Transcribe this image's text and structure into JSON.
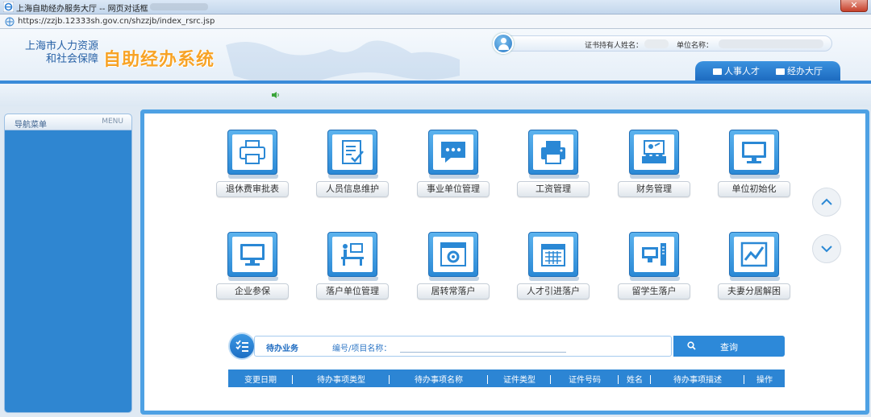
{
  "window": {
    "title": "上海自助经办服务大厅 -- 网页对话框",
    "url": "https://zzjb.12333sh.gov.cn/shzzjb/index_rsrc.jsp"
  },
  "header": {
    "org_line1": "上海市人力资源",
    "org_line2": "和社会保障",
    "system_name": "自助经办系统",
    "holder_label": "证书持有人姓名：",
    "unit_label": "单位名称："
  },
  "tabs": [
    {
      "label": "人事人才"
    },
    {
      "label": "经办大厅"
    }
  ],
  "sidebar": {
    "title": "导航菜单",
    "menu": "MENU"
  },
  "functions": [
    {
      "label": "退休费审批表",
      "icon": "printer-icon"
    },
    {
      "label": "人员信息维护",
      "icon": "document-edit-icon"
    },
    {
      "label": "事业单位管理",
      "icon": "chat-bubble-icon"
    },
    {
      "label": "工资管理",
      "icon": "printer-icon"
    },
    {
      "label": "财务管理",
      "icon": "presentation-icon"
    },
    {
      "label": "单位初始化",
      "icon": "monitor-icon"
    },
    {
      "label": "企业参保",
      "icon": "monitor-icon"
    },
    {
      "label": "落户单位管理",
      "icon": "desk-icon"
    },
    {
      "label": "居转常落户",
      "icon": "browser-gear-icon"
    },
    {
      "label": "人才引进落户",
      "icon": "calendar-icon"
    },
    {
      "label": "留学生落户",
      "icon": "computer-tower-icon"
    },
    {
      "label": "夫妻分居解困",
      "icon": "chart-icon"
    }
  ],
  "todo": {
    "title": "待办业务",
    "field_label": "编号/项目名称：",
    "field_value": "",
    "query_label": "查询"
  },
  "table": {
    "columns": [
      "变更日期",
      "待办事项类型",
      "待办事项名称",
      "证件类型",
      "证件号码",
      "姓名",
      "待办事项描述",
      "操作"
    ]
  },
  "colors": {
    "accent_blue": "#2c85d4",
    "system_name_orange": "#f7a326"
  }
}
